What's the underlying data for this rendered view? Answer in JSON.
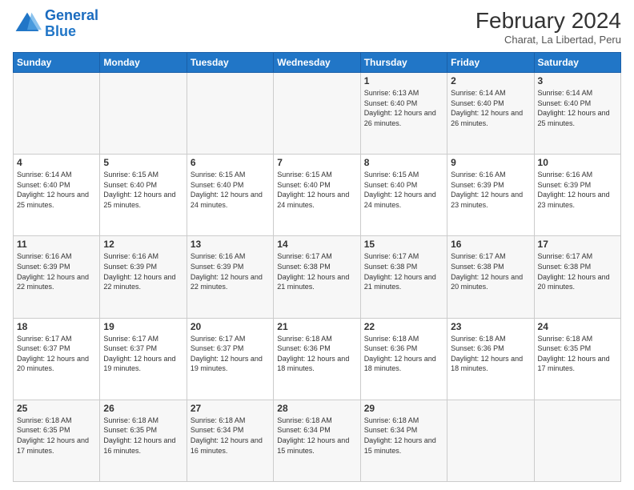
{
  "logo": {
    "line1": "General",
    "line2": "Blue"
  },
  "header": {
    "month": "February 2024",
    "location": "Charat, La Libertad, Peru"
  },
  "weekdays": [
    "Sunday",
    "Monday",
    "Tuesday",
    "Wednesday",
    "Thursday",
    "Friday",
    "Saturday"
  ],
  "weeks": [
    [
      {
        "day": "",
        "info": ""
      },
      {
        "day": "",
        "info": ""
      },
      {
        "day": "",
        "info": ""
      },
      {
        "day": "",
        "info": ""
      },
      {
        "day": "1",
        "info": "Sunrise: 6:13 AM\nSunset: 6:40 PM\nDaylight: 12 hours and 26 minutes."
      },
      {
        "day": "2",
        "info": "Sunrise: 6:14 AM\nSunset: 6:40 PM\nDaylight: 12 hours and 26 minutes."
      },
      {
        "day": "3",
        "info": "Sunrise: 6:14 AM\nSunset: 6:40 PM\nDaylight: 12 hours and 25 minutes."
      }
    ],
    [
      {
        "day": "4",
        "info": "Sunrise: 6:14 AM\nSunset: 6:40 PM\nDaylight: 12 hours and 25 minutes."
      },
      {
        "day": "5",
        "info": "Sunrise: 6:15 AM\nSunset: 6:40 PM\nDaylight: 12 hours and 25 minutes."
      },
      {
        "day": "6",
        "info": "Sunrise: 6:15 AM\nSunset: 6:40 PM\nDaylight: 12 hours and 24 minutes."
      },
      {
        "day": "7",
        "info": "Sunrise: 6:15 AM\nSunset: 6:40 PM\nDaylight: 12 hours and 24 minutes."
      },
      {
        "day": "8",
        "info": "Sunrise: 6:15 AM\nSunset: 6:40 PM\nDaylight: 12 hours and 24 minutes."
      },
      {
        "day": "9",
        "info": "Sunrise: 6:16 AM\nSunset: 6:39 PM\nDaylight: 12 hours and 23 minutes."
      },
      {
        "day": "10",
        "info": "Sunrise: 6:16 AM\nSunset: 6:39 PM\nDaylight: 12 hours and 23 minutes."
      }
    ],
    [
      {
        "day": "11",
        "info": "Sunrise: 6:16 AM\nSunset: 6:39 PM\nDaylight: 12 hours and 22 minutes."
      },
      {
        "day": "12",
        "info": "Sunrise: 6:16 AM\nSunset: 6:39 PM\nDaylight: 12 hours and 22 minutes."
      },
      {
        "day": "13",
        "info": "Sunrise: 6:16 AM\nSunset: 6:39 PM\nDaylight: 12 hours and 22 minutes."
      },
      {
        "day": "14",
        "info": "Sunrise: 6:17 AM\nSunset: 6:38 PM\nDaylight: 12 hours and 21 minutes."
      },
      {
        "day": "15",
        "info": "Sunrise: 6:17 AM\nSunset: 6:38 PM\nDaylight: 12 hours and 21 minutes."
      },
      {
        "day": "16",
        "info": "Sunrise: 6:17 AM\nSunset: 6:38 PM\nDaylight: 12 hours and 20 minutes."
      },
      {
        "day": "17",
        "info": "Sunrise: 6:17 AM\nSunset: 6:38 PM\nDaylight: 12 hours and 20 minutes."
      }
    ],
    [
      {
        "day": "18",
        "info": "Sunrise: 6:17 AM\nSunset: 6:37 PM\nDaylight: 12 hours and 20 minutes."
      },
      {
        "day": "19",
        "info": "Sunrise: 6:17 AM\nSunset: 6:37 PM\nDaylight: 12 hours and 19 minutes."
      },
      {
        "day": "20",
        "info": "Sunrise: 6:17 AM\nSunset: 6:37 PM\nDaylight: 12 hours and 19 minutes."
      },
      {
        "day": "21",
        "info": "Sunrise: 6:18 AM\nSunset: 6:36 PM\nDaylight: 12 hours and 18 minutes."
      },
      {
        "day": "22",
        "info": "Sunrise: 6:18 AM\nSunset: 6:36 PM\nDaylight: 12 hours and 18 minutes."
      },
      {
        "day": "23",
        "info": "Sunrise: 6:18 AM\nSunset: 6:36 PM\nDaylight: 12 hours and 18 minutes."
      },
      {
        "day": "24",
        "info": "Sunrise: 6:18 AM\nSunset: 6:35 PM\nDaylight: 12 hours and 17 minutes."
      }
    ],
    [
      {
        "day": "25",
        "info": "Sunrise: 6:18 AM\nSunset: 6:35 PM\nDaylight: 12 hours and 17 minutes."
      },
      {
        "day": "26",
        "info": "Sunrise: 6:18 AM\nSunset: 6:35 PM\nDaylight: 12 hours and 16 minutes."
      },
      {
        "day": "27",
        "info": "Sunrise: 6:18 AM\nSunset: 6:34 PM\nDaylight: 12 hours and 16 minutes."
      },
      {
        "day": "28",
        "info": "Sunrise: 6:18 AM\nSunset: 6:34 PM\nDaylight: 12 hours and 15 minutes."
      },
      {
        "day": "29",
        "info": "Sunrise: 6:18 AM\nSunset: 6:34 PM\nDaylight: 12 hours and 15 minutes."
      },
      {
        "day": "",
        "info": ""
      },
      {
        "day": "",
        "info": ""
      }
    ]
  ]
}
